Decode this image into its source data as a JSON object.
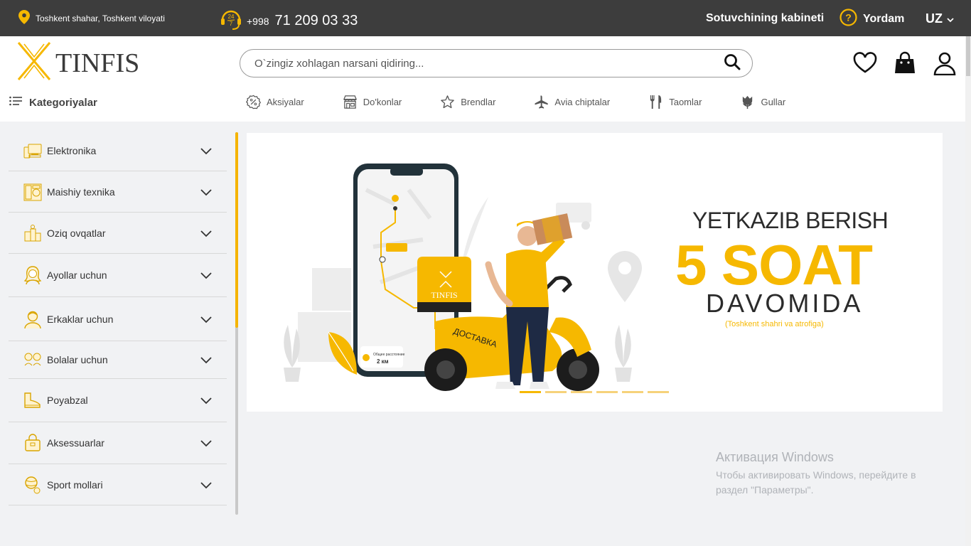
{
  "topbar": {
    "location": "Toshkent shahar, Toshkent viloyati",
    "phone_prefix": "+998",
    "phone_number": "71 209 03 33",
    "support_badge": "24/7",
    "seller_link": "Sotuvchining kabineti",
    "help_label": "Yordam",
    "language": "UZ"
  },
  "header": {
    "logo_text": "TINFIS",
    "search_placeholder": "O`zingiz xohlagan narsani qidiring...",
    "categories_label": "Kategoriyalar",
    "nav": [
      {
        "label": "Aksiyalar",
        "icon": "discount-icon"
      },
      {
        "label": "Do'konlar",
        "icon": "store-icon"
      },
      {
        "label": "Brendlar",
        "icon": "star-icon"
      },
      {
        "label": "Avia chiptalar",
        "icon": "plane-icon"
      },
      {
        "label": "Taomlar",
        "icon": "cutlery-icon"
      },
      {
        "label": "Gullar",
        "icon": "flower-icon"
      }
    ]
  },
  "sidebar": {
    "items": [
      {
        "label": "Elektronika",
        "icon": "electronics-icon"
      },
      {
        "label": "Maishiy texnika",
        "icon": "appliances-icon"
      },
      {
        "label": "Oziq ovqatlar",
        "icon": "groceries-icon"
      },
      {
        "label": "Ayollar uchun",
        "icon": "woman-icon"
      },
      {
        "label": "Erkaklar uchun",
        "icon": "man-icon"
      },
      {
        "label": "Bolalar uchun",
        "icon": "kids-icon"
      },
      {
        "label": "Poyabzal",
        "icon": "shoe-icon"
      },
      {
        "label": "Aksessuarlar",
        "icon": "accessories-icon"
      },
      {
        "label": "Sport mollari",
        "icon": "sport-icon"
      }
    ]
  },
  "banner": {
    "line1": "YETKAZIB BERISH",
    "line2": "5 SOAT",
    "line3": "DAVOMIDA",
    "line4": "(Toshkent shahri va atrofiga)",
    "scooter_text": "ДОСТАВКА",
    "box_logo": "TINFIS",
    "map_distance_label": "Общее расстояние",
    "map_distance": "2 км",
    "slides": 6,
    "active_slide": 1
  },
  "watermark": {
    "title": "Активация Windows",
    "line1": "Чтобы активировать Windows, перейдите в",
    "line2": "раздел \"Параметры\"."
  },
  "colors": {
    "accent": "#f6b800",
    "topbar": "#3d3d3d",
    "background": "#f1f2f4"
  }
}
